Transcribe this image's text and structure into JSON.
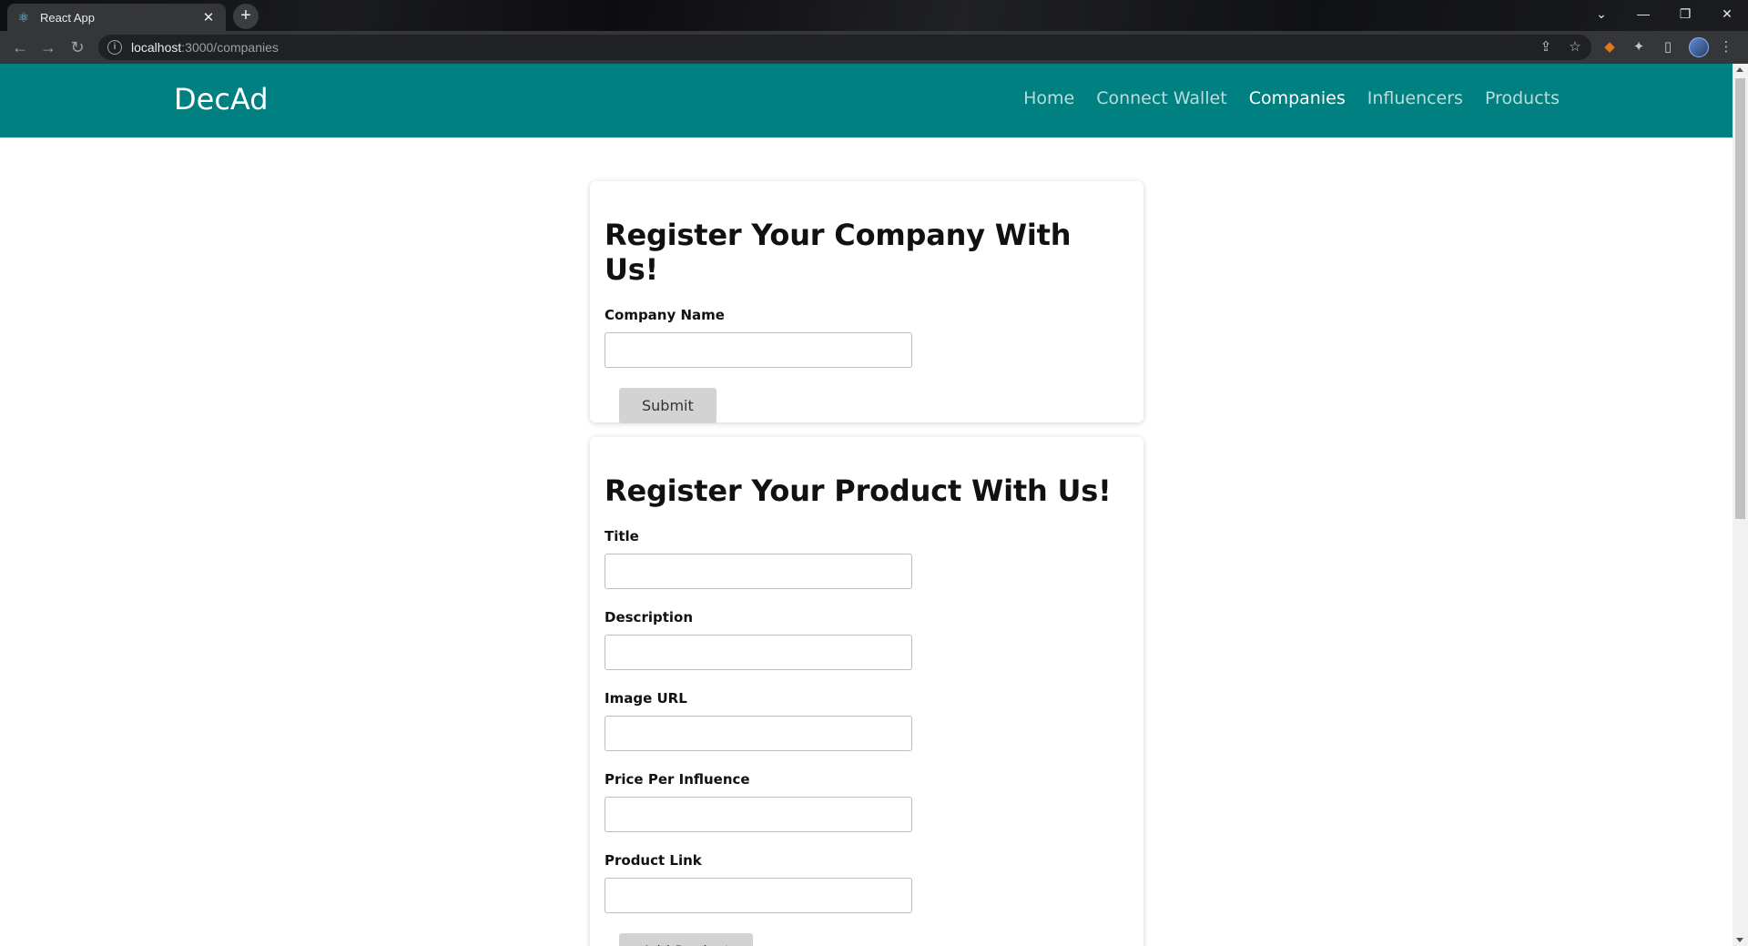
{
  "browser": {
    "tab_title": "React App",
    "tab_close": "✕",
    "new_tab": "+",
    "url_host": "localhost",
    "url_path": ":3000/companies",
    "window_controls": [
      "⌄",
      "—",
      "❐",
      "✕"
    ]
  },
  "site": {
    "brand": "DecAd",
    "nav": [
      {
        "label": "Home",
        "active": false
      },
      {
        "label": "Connect Wallet",
        "active": false
      },
      {
        "label": "Companies",
        "active": true
      },
      {
        "label": "Influencers",
        "active": false
      },
      {
        "label": "Products",
        "active": false
      }
    ],
    "colors": {
      "navbar": "#008080",
      "button": "#d3d3d3"
    }
  },
  "company_form": {
    "heading": "Register Your Company With Us!",
    "fields": [
      {
        "label": "Company Name",
        "value": ""
      }
    ],
    "submit_label": "Submit"
  },
  "product_form": {
    "heading": "Register Your Product With Us!",
    "fields": [
      {
        "label": "Title",
        "value": ""
      },
      {
        "label": "Description",
        "value": ""
      },
      {
        "label": "Image URL",
        "value": ""
      },
      {
        "label": "Price Per Influence",
        "value": ""
      },
      {
        "label": "Product Link",
        "value": ""
      }
    ],
    "submit_label": "Add Product"
  }
}
